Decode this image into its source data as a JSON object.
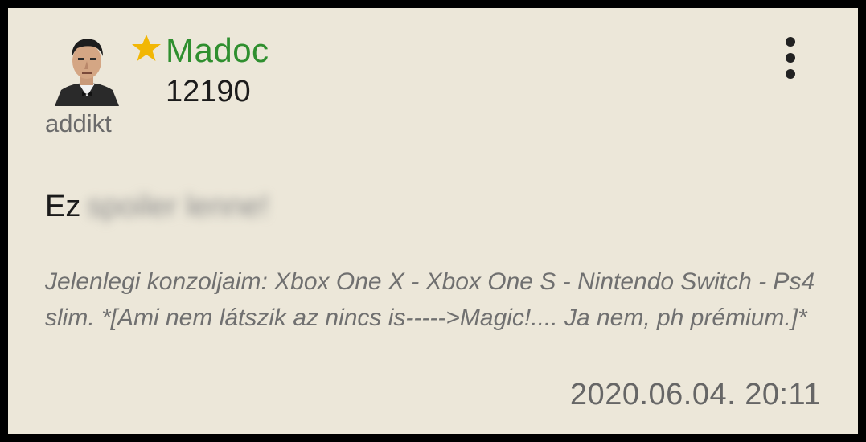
{
  "post": {
    "author": {
      "name": "Madoc",
      "score": "12190",
      "rank": "addikt",
      "badge_icon": "star-icon",
      "avatar_icon": "avatar-portrait"
    },
    "menu_icon": "more-vert-icon",
    "body": {
      "prefix": "Ez",
      "spoiler_text": "spoiler lenne!"
    },
    "signature": "Jelenlegi konzoljaim: Xbox One X - Xbox One S - Nintendo Switch - Ps4 slim. *[Ami nem látszik az nincs is----->Magic!.... Ja nem, ph prémium.]*",
    "timestamp": "2020.06.04. 20:11"
  },
  "colors": {
    "background": "#ece7d9",
    "username": "#2f8f2f",
    "star": "#f2b705",
    "muted": "#707070"
  }
}
